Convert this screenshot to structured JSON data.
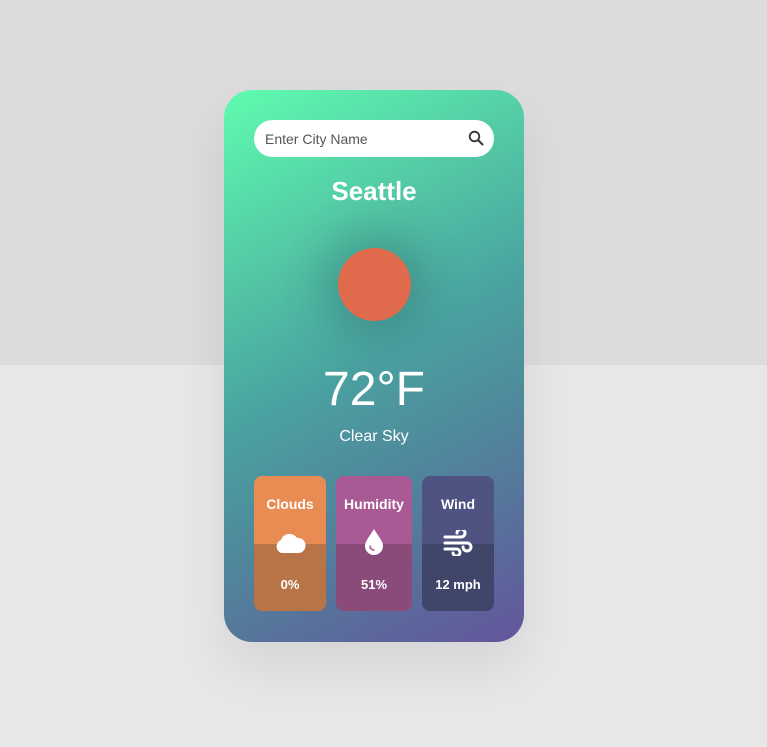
{
  "search": {
    "placeholder": "Enter City Name",
    "icon": "search-icon"
  },
  "city": "Seattle",
  "weather": {
    "icon": "sun-icon",
    "temperature": "72°F",
    "description": "Clear Sky"
  },
  "details": [
    {
      "label": "Clouds",
      "icon": "cloud-icon",
      "value": "0%"
    },
    {
      "label": "Humidity",
      "icon": "droplet-icon",
      "value": "51%"
    },
    {
      "label": "Wind",
      "icon": "wind-icon",
      "value": "12 mph"
    }
  ],
  "colors": {
    "clouds_tile": "#e98c54",
    "humidity_tile": "#a95a94",
    "wind_tile": "#4e5382",
    "sun": "#e06b4c"
  }
}
